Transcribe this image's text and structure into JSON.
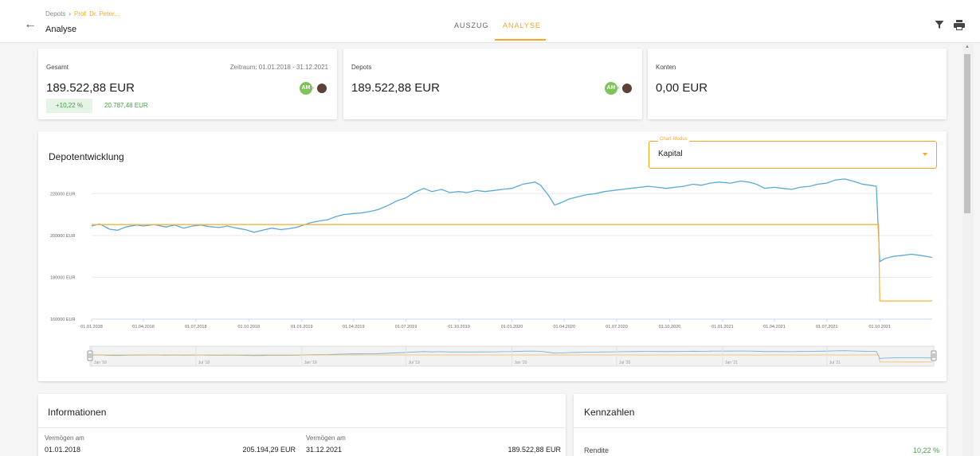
{
  "header": {
    "breadcrumb_parent": "Depots",
    "breadcrumb_current": "Prof. Dr. Peter...",
    "page_title": "Analyse",
    "tabs": [
      {
        "label": "AUSZUG"
      },
      {
        "label": "ANALYSE"
      }
    ],
    "accent_color": "#f6a623"
  },
  "summary_cards": {
    "gesamt": {
      "label": "Gesamt",
      "zeitraum": "Zeitraum: 01.01.2018 - 31.12.2021",
      "value": "189.522,88 EUR",
      "change_pct": "+10,22 %",
      "change_abs": "20.787,48 EUR",
      "avatar_initials": "AM"
    },
    "depots": {
      "label": "Depots",
      "value": "189.522,88 EUR",
      "avatar_initials": "AM"
    },
    "konten": {
      "label": "Konten",
      "value": "0,00 EUR"
    }
  },
  "chart_section": {
    "title": "Depotentwicklung",
    "mode_label": "Chart-Modus",
    "mode_value": "Kapital"
  },
  "chart_data": {
    "type": "line",
    "ylim": [
      160000,
      230000
    ],
    "yticks": [
      {
        "v": 220000,
        "label": "220000 EUR"
      },
      {
        "v": 200000,
        "label": "200000 EUR"
      },
      {
        "v": 180000,
        "label": "180000 EUR"
      },
      {
        "v": 160000,
        "label": "160000 EUR"
      }
    ],
    "x_range": [
      "2018-01-01",
      "2021-12-31"
    ],
    "xticks": [
      "01.01.2018",
      "01.04.2018",
      "01.07.2018",
      "01.10.2018",
      "01.01.2019",
      "01.04.2019",
      "01.07.2019",
      "01.10.2019",
      "01.01.2020",
      "01.04.2020",
      "01.07.2020",
      "01.10.2020",
      "01.01.2021",
      "01.04.2021",
      "01.07.2021",
      "01.10.2021"
    ],
    "navigator_ticks": [
      "Jan '18",
      "Jul '18",
      "Jan '19",
      "Jul '19",
      "Jan '20",
      "Jul '20",
      "Jan '21",
      "Jul '21"
    ],
    "series": [
      {
        "color": "#5aa9d6",
        "points": [
          [
            "2018-01-01",
            204500
          ],
          [
            "2018-01-15",
            205500
          ],
          [
            "2018-02-01",
            203000
          ],
          [
            "2018-02-15",
            202500
          ],
          [
            "2018-03-01",
            204000
          ],
          [
            "2018-03-20",
            205000
          ],
          [
            "2018-04-01",
            204500
          ],
          [
            "2018-04-20",
            205200
          ],
          [
            "2018-05-10",
            204000
          ],
          [
            "2018-05-25",
            205000
          ],
          [
            "2018-06-10",
            203500
          ],
          [
            "2018-06-25",
            204500
          ],
          [
            "2018-07-10",
            205000
          ],
          [
            "2018-07-25",
            204200
          ],
          [
            "2018-08-10",
            203800
          ],
          [
            "2018-08-25",
            204500
          ],
          [
            "2018-09-10",
            203500
          ],
          [
            "2018-09-25",
            202800
          ],
          [
            "2018-10-10",
            201500
          ],
          [
            "2018-10-25",
            202500
          ],
          [
            "2018-11-10",
            203500
          ],
          [
            "2018-11-25",
            202800
          ],
          [
            "2018-12-10",
            203200
          ],
          [
            "2018-12-25",
            204000
          ],
          [
            "2019-01-15",
            206000
          ],
          [
            "2019-02-01",
            207000
          ],
          [
            "2019-02-15",
            207500
          ],
          [
            "2019-03-01",
            209000
          ],
          [
            "2019-03-15",
            210000
          ],
          [
            "2019-04-01",
            210500
          ],
          [
            "2019-04-15",
            210800
          ],
          [
            "2019-05-01",
            211500
          ],
          [
            "2019-05-15",
            212500
          ],
          [
            "2019-06-01",
            214500
          ],
          [
            "2019-06-15",
            216500
          ],
          [
            "2019-07-01",
            218000
          ],
          [
            "2019-07-15",
            220500
          ],
          [
            "2019-08-01",
            222500
          ],
          [
            "2019-08-15",
            221000
          ],
          [
            "2019-09-01",
            222000
          ],
          [
            "2019-09-15",
            220500
          ],
          [
            "2019-10-01",
            221000
          ],
          [
            "2019-10-15",
            220500
          ],
          [
            "2019-11-01",
            221500
          ],
          [
            "2019-11-15",
            221000
          ],
          [
            "2019-12-01",
            221500
          ],
          [
            "2019-12-15",
            222000
          ],
          [
            "2020-01-01",
            222500
          ],
          [
            "2020-01-20",
            224500
          ],
          [
            "2020-02-10",
            225500
          ],
          [
            "2020-02-20",
            224000
          ],
          [
            "2020-03-05",
            219000
          ],
          [
            "2020-03-15",
            214500
          ],
          [
            "2020-03-25",
            215500
          ],
          [
            "2020-04-10",
            217500
          ],
          [
            "2020-04-25",
            218500
          ],
          [
            "2020-05-10",
            219500
          ],
          [
            "2020-05-25",
            220000
          ],
          [
            "2020-06-10",
            221000
          ],
          [
            "2020-06-25",
            221500
          ],
          [
            "2020-07-10",
            222000
          ],
          [
            "2020-07-25",
            222500
          ],
          [
            "2020-08-10",
            223000
          ],
          [
            "2020-08-25",
            223500
          ],
          [
            "2020-09-10",
            223000
          ],
          [
            "2020-09-25",
            222500
          ],
          [
            "2020-10-10",
            223000
          ],
          [
            "2020-10-25",
            223500
          ],
          [
            "2020-11-10",
            224500
          ],
          [
            "2020-11-25",
            224000
          ],
          [
            "2020-12-10",
            225000
          ],
          [
            "2020-12-25",
            225500
          ],
          [
            "2021-01-15",
            225000
          ],
          [
            "2021-02-01",
            226000
          ],
          [
            "2021-02-15",
            225500
          ],
          [
            "2021-03-01",
            224500
          ],
          [
            "2021-03-15",
            222500
          ],
          [
            "2021-04-01",
            223000
          ],
          [
            "2021-04-15",
            222500
          ],
          [
            "2021-05-01",
            222000
          ],
          [
            "2021-05-15",
            223000
          ],
          [
            "2021-06-01",
            223500
          ],
          [
            "2021-06-15",
            224500
          ],
          [
            "2021-07-01",
            225000
          ],
          [
            "2021-07-15",
            226500
          ],
          [
            "2021-08-01",
            227000
          ],
          [
            "2021-08-15",
            226000
          ],
          [
            "2021-09-01",
            224500
          ],
          [
            "2021-09-15",
            224000
          ],
          [
            "2021-09-25",
            223500
          ],
          [
            "2021-10-01",
            187500
          ],
          [
            "2021-10-10",
            189000
          ],
          [
            "2021-10-25",
            190000
          ],
          [
            "2021-11-10",
            190500
          ],
          [
            "2021-11-25",
            191000
          ],
          [
            "2021-12-10",
            190500
          ],
          [
            "2021-12-31",
            189500
          ]
        ]
      },
      {
        "color": "#f6b43d",
        "points": [
          [
            "2018-01-01",
            205194.29
          ],
          [
            "2021-09-29",
            205194.29
          ],
          [
            "2021-10-01",
            168700
          ],
          [
            "2021-12-31",
            168700
          ]
        ]
      }
    ]
  },
  "informationen": {
    "title": "Informationen",
    "left_label": "Vermögen am",
    "left_date": "01.01.2018",
    "left_value": "205.194,29 EUR",
    "right_label": "Vermögen am",
    "right_date": "31.12.2021",
    "right_value": "189.522,88 EUR"
  },
  "kennzahlen": {
    "title": "Kennzahlen",
    "rendite_label": "Rendite",
    "rendite_value": "10,22 %",
    "positive_color": "#43a047"
  }
}
